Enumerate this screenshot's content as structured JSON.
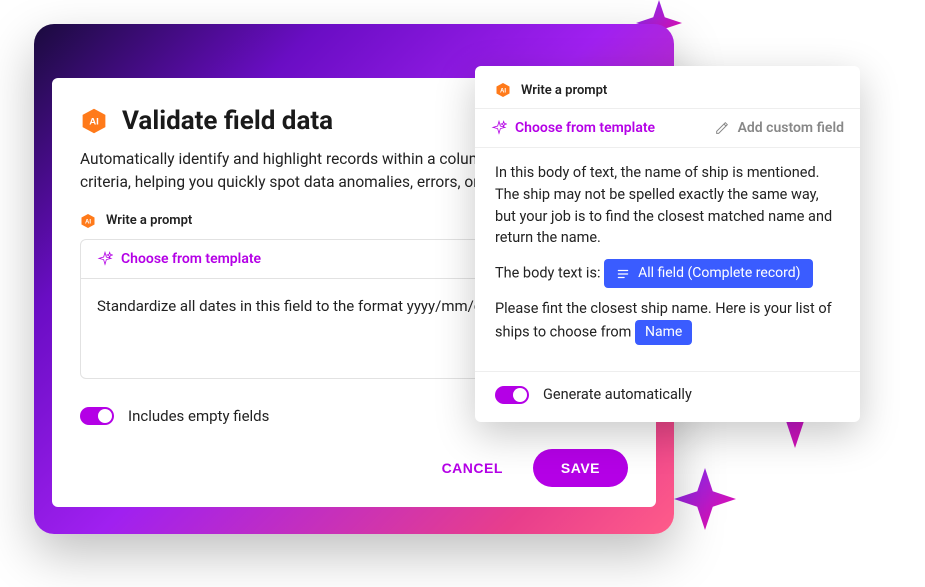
{
  "colors": {
    "accent": "#b400e6",
    "chip": "#3a5cff"
  },
  "main": {
    "title": "Validate field data",
    "description": "Automatically identify and highlight records within a column that match specific criteria, helping you quickly spot data anomalies, errors, or key insights.",
    "prompt_label": "Write a prompt",
    "template_tab": "Choose from template",
    "prompt_text": "Standardize all dates in this field to the format yyyy/mm/dd.",
    "toggle_label": "Includes empty fields",
    "cancel": "CANCEL",
    "save": "SAVE"
  },
  "popup": {
    "prompt_label": "Write a prompt",
    "template_tab": "Choose from template",
    "custom_tab": "Add custom field",
    "para1": "In this body of text, the name of ship is mentioned. The ship may not be spelled exactly the same way, but your job is to find the closest matched name and return the name.",
    "body_prefix": "The body text is:",
    "chip_all": "All field (Complete record)",
    "para3_a": "Please fint the closest ship name. Here is your list of ships to choose from",
    "chip_name": "Name",
    "toggle_label": "Generate automatically"
  }
}
